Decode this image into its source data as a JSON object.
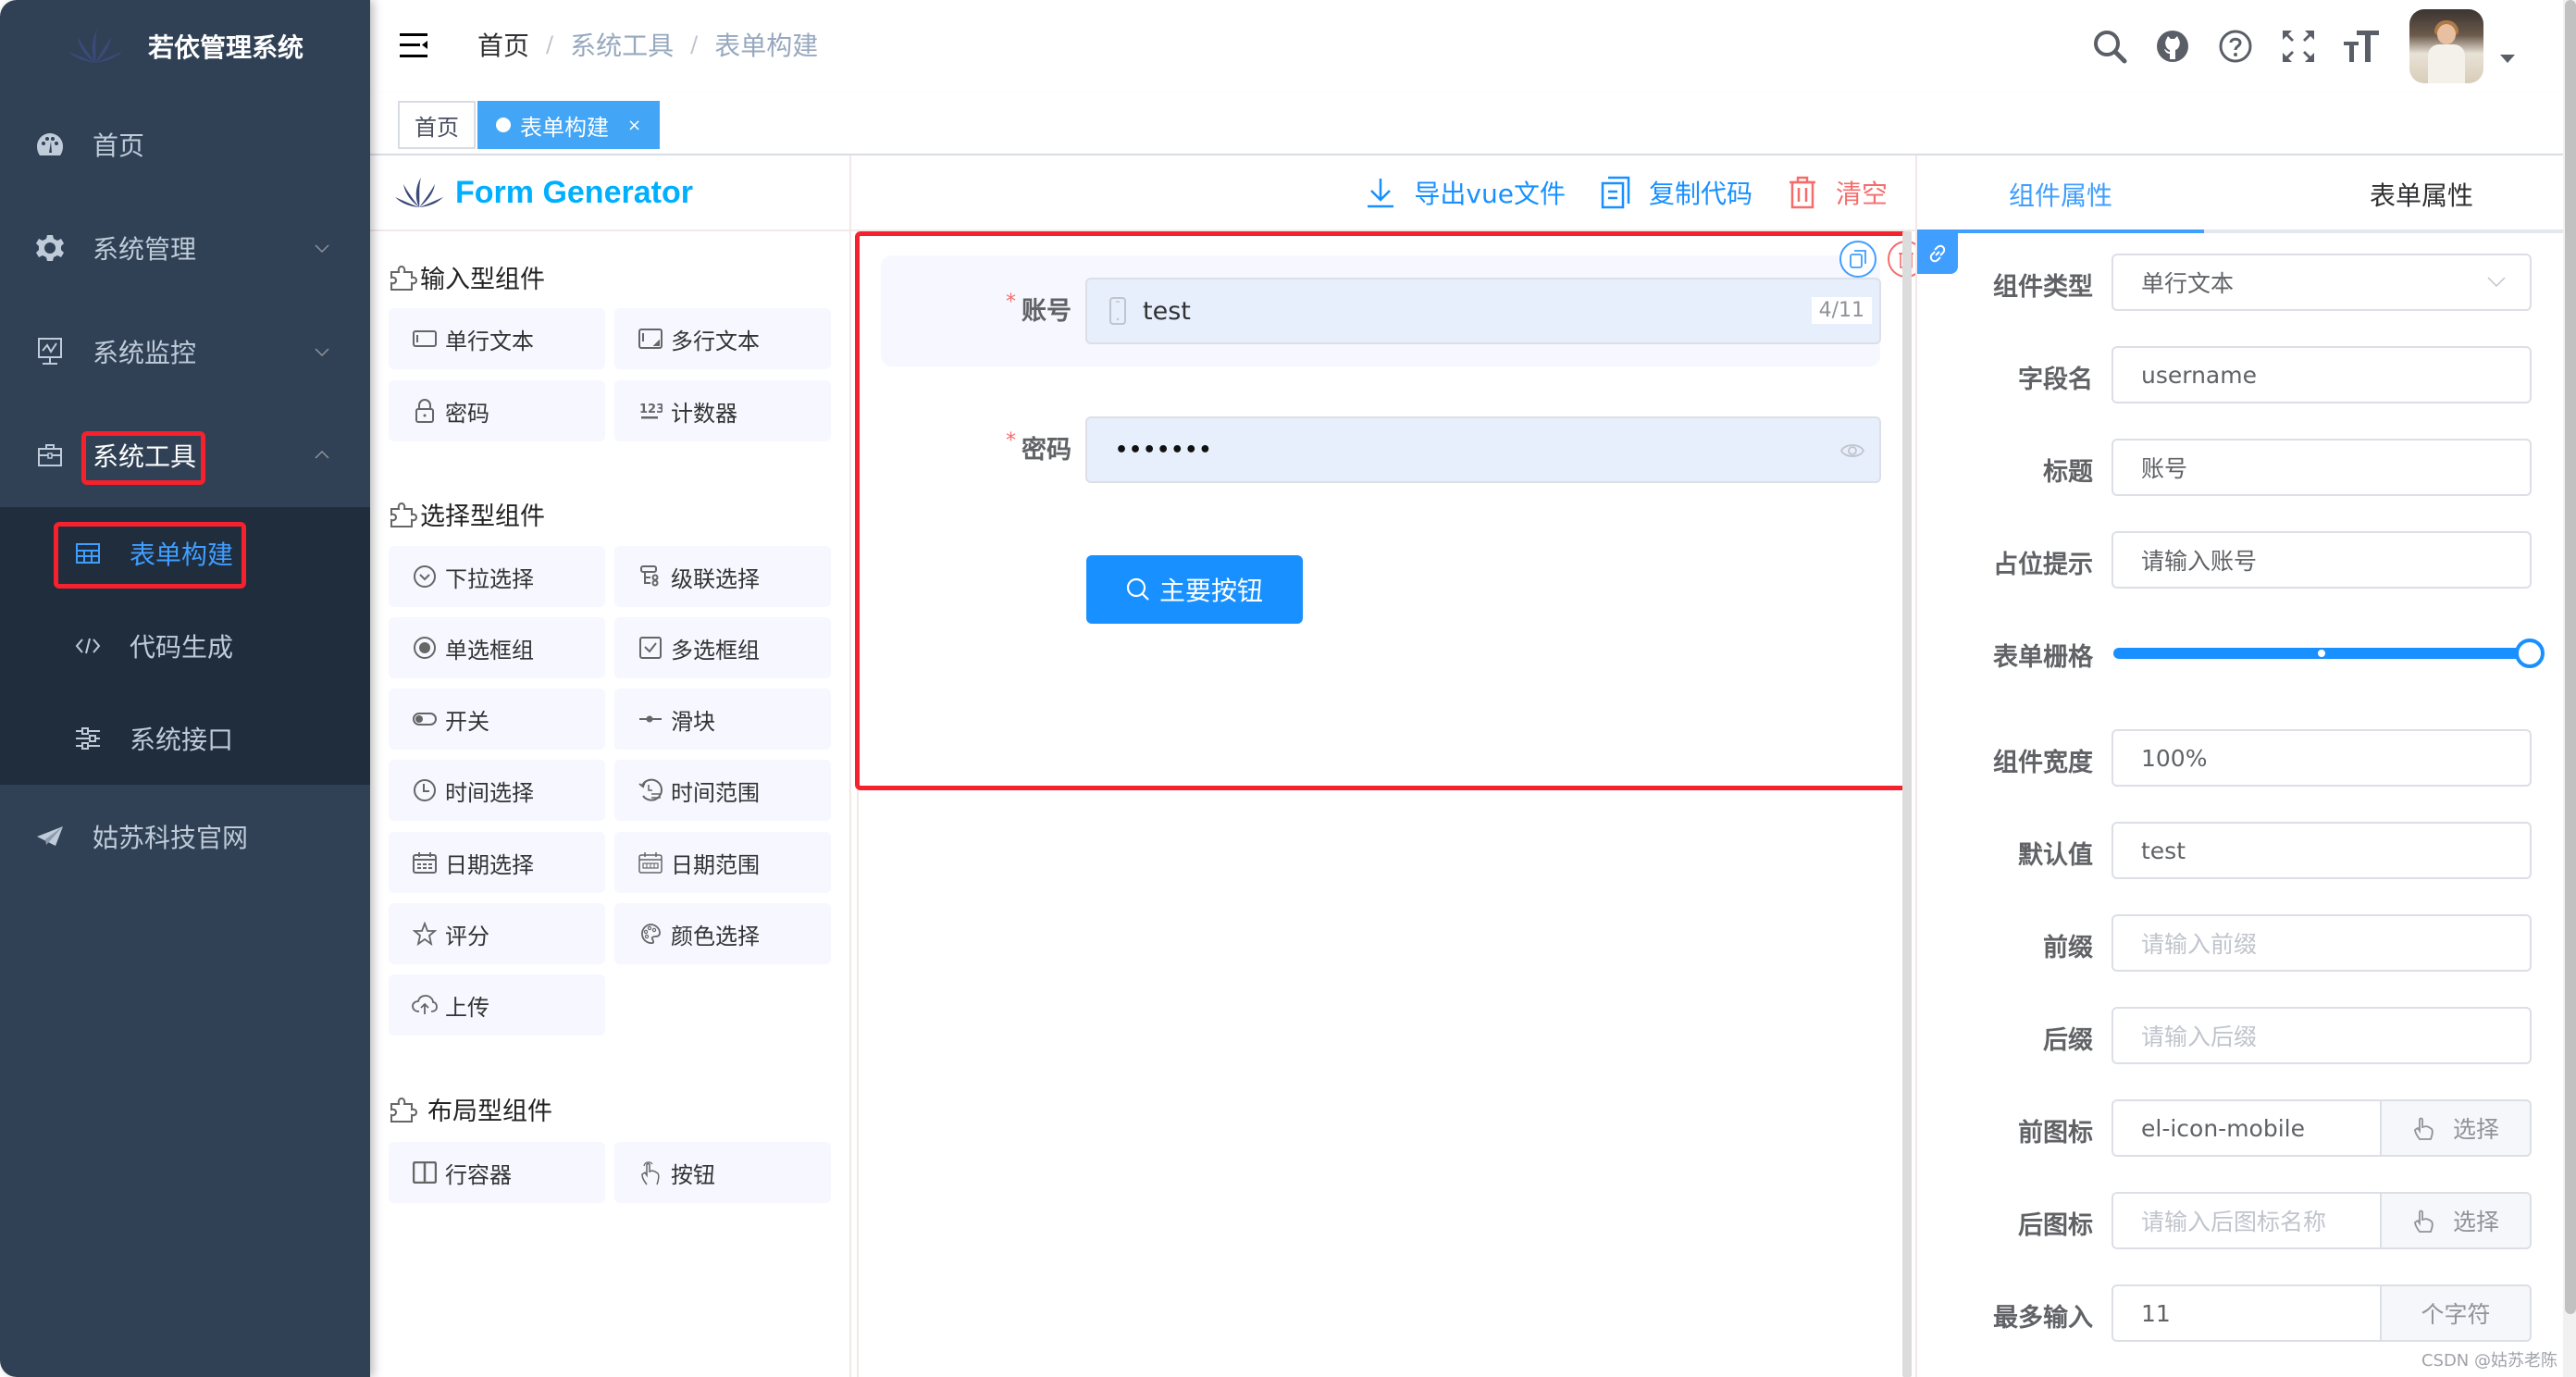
{
  "app": {
    "title": "若依管理系统",
    "accent": "#409eff",
    "sidebar_bg": "#304156",
    "danger": "#f56c6c"
  },
  "sidebar": {
    "items": [
      {
        "label": "首页",
        "icon": "dashboard-icon"
      },
      {
        "label": "系统管理",
        "icon": "gear-icon",
        "expandable": true
      },
      {
        "label": "系统监控",
        "icon": "monitor-icon",
        "expandable": true
      },
      {
        "label": "系统工具",
        "icon": "toolbox-icon",
        "expandable": true,
        "expanded": true
      },
      {
        "label": "姑苏科技官网",
        "icon": "paper-plane-icon"
      }
    ],
    "submenu": [
      {
        "label": "表单构建",
        "icon": "table-icon",
        "active": true
      },
      {
        "label": "代码生成",
        "icon": "code-icon"
      },
      {
        "label": "系统接口",
        "icon": "sliders-icon"
      }
    ]
  },
  "navbar": {
    "breadcrumb": [
      "首页",
      "系统工具",
      "表单构建"
    ],
    "breadcrumb_separator": "/",
    "icons": [
      "search-icon",
      "github-icon",
      "question-icon",
      "fullscreen-icon",
      "font-size-icon"
    ]
  },
  "tags": [
    {
      "label": "首页",
      "active": false
    },
    {
      "label": "表单构建",
      "active": true,
      "close": "×"
    }
  ],
  "left_board": {
    "title": "Form Generator",
    "groups": [
      {
        "title": "输入型组件",
        "items": [
          {
            "label": "单行文本",
            "icon": "input-icon"
          },
          {
            "label": "多行文本",
            "icon": "textarea-icon"
          },
          {
            "label": "密码",
            "icon": "lock-icon"
          },
          {
            "label": "计数器",
            "icon": "number-icon"
          }
        ]
      },
      {
        "title": "选择型组件",
        "items": [
          {
            "label": "下拉选择",
            "icon": "select-icon"
          },
          {
            "label": "级联选择",
            "icon": "cascader-icon"
          },
          {
            "label": "单选框组",
            "icon": "radio-icon"
          },
          {
            "label": "多选框组",
            "icon": "checkbox-icon"
          },
          {
            "label": "开关",
            "icon": "switch-icon"
          },
          {
            "label": "滑块",
            "icon": "slider-icon"
          },
          {
            "label": "时间选择",
            "icon": "clock-icon"
          },
          {
            "label": "时间范围",
            "icon": "time-range-icon"
          },
          {
            "label": "日期选择",
            "icon": "calendar-icon"
          },
          {
            "label": "日期范围",
            "icon": "date-range-icon"
          },
          {
            "label": "评分",
            "icon": "star-icon"
          },
          {
            "label": "颜色选择",
            "icon": "palette-icon"
          },
          {
            "label": "上传",
            "icon": "upload-icon"
          }
        ]
      },
      {
        "title": "布局型组件",
        "items": [
          {
            "label": "行容器",
            "icon": "row-icon"
          },
          {
            "label": "按钮",
            "icon": "pointer-icon"
          }
        ]
      }
    ]
  },
  "center": {
    "actions": [
      {
        "label": "导出vue文件",
        "icon": "download-icon"
      },
      {
        "label": "复制代码",
        "icon": "copy-icon"
      },
      {
        "label": "清空",
        "icon": "trash-icon",
        "danger": true
      }
    ],
    "form": {
      "account": {
        "label": "账号",
        "required": true,
        "value": "test",
        "count": "4/11"
      },
      "password": {
        "label": "密码",
        "required": true,
        "value": "•••••••"
      },
      "button": {
        "label": "主要按钮"
      }
    }
  },
  "right_board": {
    "tabs": [
      {
        "label": "组件属性",
        "active": true
      },
      {
        "label": "表单属性",
        "active": false
      }
    ],
    "props": {
      "component_type": {
        "label": "组件类型",
        "value": "单行文本"
      },
      "field_name": {
        "label": "字段名",
        "value": "username"
      },
      "title": {
        "label": "标题",
        "value": "账号"
      },
      "placeholder": {
        "label": "占位提示",
        "value": "请输入账号"
      },
      "span": {
        "label": "表单栅格",
        "value": 24,
        "max": 24
      },
      "width": {
        "label": "组件宽度",
        "value": "100%"
      },
      "default_value": {
        "label": "默认值",
        "value": "test"
      },
      "prepend": {
        "label": "前缀",
        "placeholder": "请输入前缀"
      },
      "append": {
        "label": "后缀",
        "placeholder": "请输入后缀"
      },
      "prefix_icon": {
        "label": "前图标",
        "value": "el-icon-mobile",
        "button": "选择"
      },
      "suffix_icon": {
        "label": "后图标",
        "placeholder": "请输入后图标名称",
        "button": "选择"
      },
      "maxlength": {
        "label": "最多输入",
        "value": "11",
        "append": "个字符"
      }
    }
  },
  "watermark": "CSDN @姑苏老陈"
}
